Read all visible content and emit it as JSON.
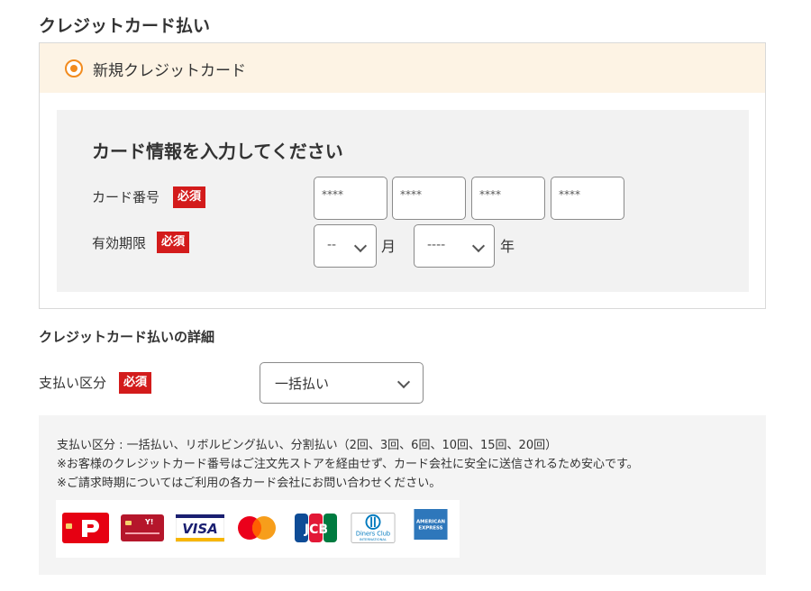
{
  "section_title": "クレジットカード払い",
  "new_card": {
    "label": "新規クレジットカード",
    "selected": true
  },
  "card_form": {
    "title": "カード情報を入力してください",
    "required_badge": "必須",
    "card_number_label": "カード番号",
    "card_number_placeholders": [
      "****",
      "****",
      "****",
      "****"
    ],
    "expiry_label": "有効期限",
    "month_value": "--",
    "month_unit": "月",
    "year_value": "----",
    "year_unit": "年"
  },
  "details": {
    "title": "クレジットカード払いの詳細",
    "payment_type_label": "支払い区分",
    "payment_type_value": "一括払い"
  },
  "info": {
    "lines": [
      "支払い区分 : 一括払い、リボルビング払い、分割払い（2回、3回、6回、10回、15回、20回）",
      "※お客様のクレジットカード番号はご注文先ストアを経由せず、カード会社に安全に送信されるため安心です。",
      "※ご請求時期についてはご利用の各カード会社にお問い合わせください。"
    ],
    "card_brands": [
      "PayPay",
      "Yahoo! JAPAN",
      "VISA",
      "Mastercard",
      "JCB",
      "Diners Club International",
      "American Express"
    ],
    "logo_text": {
      "visa": "VISA",
      "jcb": "JCB",
      "diners_1": "Diners Club",
      "diners_2": "INTERNATIONAL",
      "amex_1": "AMERICAN",
      "amex_2": "EXPRESS"
    }
  },
  "colors": {
    "accent": "#f28b1e",
    "badge": "#d31b1b",
    "header_bg": "#fdf3e4",
    "panel_bg": "#f2f2f2"
  }
}
